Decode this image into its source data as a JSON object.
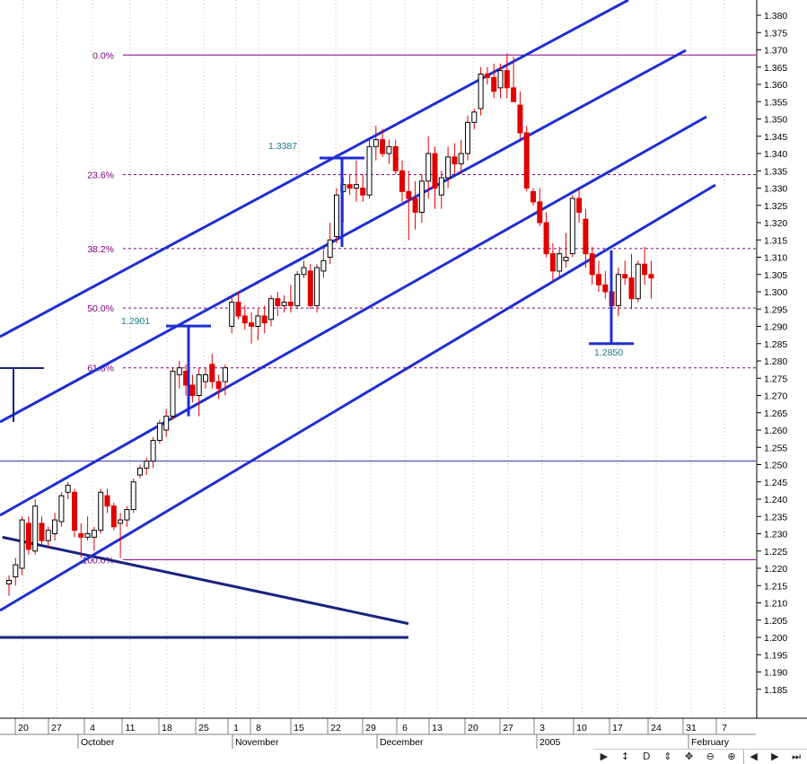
{
  "colors": {
    "background": "#ffffff",
    "grid": "#c0c0c0",
    "axis_text": "#000000",
    "up_candle": "#ffffff",
    "down_candle": "#e00000",
    "wick": "#e00000",
    "fib": "#800080",
    "fib_label": "#800080",
    "trend": "#1f2fd0",
    "dark_line": "#1a237e",
    "annotation": "#1a7a8a",
    "hline": "#3030c0"
  },
  "toolbar": {
    "play_label": "▶",
    "cycle_label": "↕",
    "d_label": "D",
    "updown_label": "⇕",
    "move_label": "✥",
    "zoom_out_label": "⊖",
    "zoom_in_label": "⊕",
    "left_label": "◀",
    "right_label": "▶",
    "end_label": "⏭"
  },
  "chart_data": {
    "type": "candlestick",
    "title": "",
    "xlabel": "",
    "ylabel": "",
    "ylim": [
      1.181,
      1.385
    ],
    "y_ticks": [
      "1.380",
      "1.375",
      "1.370",
      "1.365",
      "1.360",
      "1.355",
      "1.350",
      "1.345",
      "1.340",
      "1.335",
      "1.330",
      "1.325",
      "1.320",
      "1.315",
      "1.310",
      "1.305",
      "1.300",
      "1.295",
      "1.290",
      "1.285",
      "1.280",
      "1.275",
      "1.270",
      "1.265",
      "1.260",
      "1.255",
      "1.250",
      "1.245",
      "1.240",
      "1.235",
      "1.230",
      "1.225",
      "1.220",
      "1.215",
      "1.210",
      "1.205",
      "1.200",
      "1.195",
      "1.190",
      "1.185"
    ],
    "x_day_ticks": [
      "20",
      "27",
      "4",
      "11",
      "18",
      "25",
      "1",
      "8",
      "15",
      "22",
      "29",
      "6",
      "13",
      "20",
      "27",
      "3",
      "10",
      "17",
      "24",
      "31",
      "7"
    ],
    "x_month_labels": [
      "October",
      "November",
      "December",
      "2005",
      "February"
    ],
    "grid": "vertical weekly dotted",
    "fibonacci_levels": [
      {
        "label": "0.0%",
        "value": 1.3685
      },
      {
        "label": "23.6%",
        "value": 1.3339
      },
      {
        "label": "38.2%",
        "value": 1.3125
      },
      {
        "label": "50.0%",
        "value": 1.2953
      },
      {
        "label": "61.8%",
        "value": 1.278
      },
      {
        "label": "100.0%",
        "value": 1.2225
      }
    ],
    "annotations": [
      {
        "label": "1.3387",
        "value": 1.3387
      },
      {
        "label": "1.2901",
        "value": 1.2901
      },
      {
        "label": "1.2850",
        "value": 1.285
      }
    ],
    "horizontal_lines": [
      1.251,
      1.2
    ],
    "trend_channel_lines": [
      {
        "x1": -1,
        "y1": 1.288,
        "x2": 50,
        "y2": 1.385
      },
      {
        "x1": -1,
        "y1": 1.261,
        "x2": 54,
        "y2": 1.369
      },
      {
        "x1": -1,
        "y1": 1.235,
        "x2": 55,
        "y2": 1.349
      },
      {
        "x1": -1,
        "y1": 1.211,
        "x2": 56,
        "y2": 1.329
      }
    ],
    "descending_line": {
      "x1": -1,
      "y1": 1.229,
      "x2": 31,
      "y2": 1.204
    },
    "candles": [
      {
        "o": 1.2155,
        "h": 1.218,
        "l": 1.212,
        "c": 1.2165
      },
      {
        "o": 1.2175,
        "h": 1.223,
        "l": 1.215,
        "c": 1.221
      },
      {
        "o": 1.22,
        "h": 1.235,
        "l": 1.218,
        "c": 1.234
      },
      {
        "o": 1.233,
        "h": 1.235,
        "l": 1.224,
        "c": 1.2255
      },
      {
        "o": 1.225,
        "h": 1.24,
        "l": 1.224,
        "c": 1.238
      },
      {
        "o": 1.233,
        "h": 1.235,
        "l": 1.227,
        "c": 1.228
      },
      {
        "o": 1.228,
        "h": 1.232,
        "l": 1.226,
        "c": 1.231
      },
      {
        "o": 1.23,
        "h": 1.236,
        "l": 1.228,
        "c": 1.234
      },
      {
        "o": 1.2335,
        "h": 1.242,
        "l": 1.232,
        "c": 1.241
      },
      {
        "o": 1.242,
        "h": 1.245,
        "l": 1.24,
        "c": 1.244
      },
      {
        "o": 1.242,
        "h": 1.243,
        "l": 1.229,
        "c": 1.231
      },
      {
        "o": 1.23,
        "h": 1.233,
        "l": 1.223,
        "c": 1.229
      },
      {
        "o": 1.229,
        "h": 1.235,
        "l": 1.228,
        "c": 1.23
      },
      {
        "o": 1.229,
        "h": 1.232,
        "l": 1.225,
        "c": 1.231
      },
      {
        "o": 1.231,
        "h": 1.243,
        "l": 1.23,
        "c": 1.242
      },
      {
        "o": 1.241,
        "h": 1.243,
        "l": 1.236,
        "c": 1.238
      },
      {
        "o": 1.238,
        "h": 1.239,
        "l": 1.231,
        "c": 1.232
      },
      {
        "o": 1.233,
        "h": 1.236,
        "l": 1.223,
        "c": 1.234
      },
      {
        "o": 1.234,
        "h": 1.238,
        "l": 1.232,
        "c": 1.237
      },
      {
        "o": 1.237,
        "h": 1.246,
        "l": 1.236,
        "c": 1.245
      },
      {
        "o": 1.247,
        "h": 1.25,
        "l": 1.246,
        "c": 1.249
      },
      {
        "o": 1.249,
        "h": 1.252,
        "l": 1.247,
        "c": 1.251
      },
      {
        "o": 1.251,
        "h": 1.258,
        "l": 1.249,
        "c": 1.257
      },
      {
        "o": 1.257,
        "h": 1.263,
        "l": 1.256,
        "c": 1.262
      },
      {
        "o": 1.26,
        "h": 1.266,
        "l": 1.258,
        "c": 1.264
      },
      {
        "o": 1.264,
        "h": 1.278,
        "l": 1.263,
        "c": 1.277
      },
      {
        "o": 1.276,
        "h": 1.28,
        "l": 1.272,
        "c": 1.278
      },
      {
        "o": 1.277,
        "h": 1.279,
        "l": 1.27,
        "c": 1.273
      },
      {
        "o": 1.273,
        "h": 1.276,
        "l": 1.268,
        "c": 1.27
      },
      {
        "o": 1.27,
        "h": 1.278,
        "l": 1.264,
        "c": 1.276
      },
      {
        "o": 1.274,
        "h": 1.278,
        "l": 1.272,
        "c": 1.276
      },
      {
        "o": 1.279,
        "h": 1.282,
        "l": 1.272,
        "c": 1.274
      },
      {
        "o": 1.274,
        "h": 1.276,
        "l": 1.269,
        "c": 1.272
      },
      {
        "o": 1.274,
        "h": 1.279,
        "l": 1.27,
        "c": 1.278
      },
      {
        "o": 1.29,
        "h": 1.299,
        "l": 1.288,
        "c": 1.297
      },
      {
        "o": 1.297,
        "h": 1.3,
        "l": 1.292,
        "c": 1.293
      },
      {
        "o": 1.293,
        "h": 1.296,
        "l": 1.289,
        "c": 1.291
      },
      {
        "o": 1.291,
        "h": 1.294,
        "l": 1.285,
        "c": 1.29
      },
      {
        "o": 1.29,
        "h": 1.295,
        "l": 1.286,
        "c": 1.293
      },
      {
        "o": 1.293,
        "h": 1.296,
        "l": 1.288,
        "c": 1.291
      },
      {
        "o": 1.292,
        "h": 1.299,
        "l": 1.29,
        "c": 1.298
      },
      {
        "o": 1.298,
        "h": 1.3,
        "l": 1.293,
        "c": 1.296
      },
      {
        "o": 1.296,
        "h": 1.299,
        "l": 1.294,
        "c": 1.297
      },
      {
        "o": 1.297,
        "h": 1.302,
        "l": 1.294,
        "c": 1.296
      },
      {
        "o": 1.296,
        "h": 1.306,
        "l": 1.295,
        "c": 1.305
      },
      {
        "o": 1.305,
        "h": 1.309,
        "l": 1.304,
        "c": 1.307
      },
      {
        "o": 1.306,
        "h": 1.308,
        "l": 1.295,
        "c": 1.296
      },
      {
        "o": 1.296,
        "h": 1.308,
        "l": 1.294,
        "c": 1.307
      },
      {
        "o": 1.306,
        "h": 1.312,
        "l": 1.304,
        "c": 1.309
      },
      {
        "o": 1.31,
        "h": 1.32,
        "l": 1.308,
        "c": 1.315
      },
      {
        "o": 1.316,
        "h": 1.33,
        "l": 1.314,
        "c": 1.328
      },
      {
        "o": 1.329,
        "h": 1.333,
        "l": 1.32,
        "c": 1.331
      },
      {
        "o": 1.331,
        "h": 1.334,
        "l": 1.328,
        "c": 1.33
      },
      {
        "o": 1.33,
        "h": 1.338,
        "l": 1.326,
        "c": 1.331
      },
      {
        "o": 1.33,
        "h": 1.334,
        "l": 1.326,
        "c": 1.328
      },
      {
        "o": 1.328,
        "h": 1.344,
        "l": 1.327,
        "c": 1.342
      },
      {
        "o": 1.342,
        "h": 1.348,
        "l": 1.338,
        "c": 1.344
      },
      {
        "o": 1.344,
        "h": 1.347,
        "l": 1.339,
        "c": 1.34
      },
      {
        "o": 1.34,
        "h": 1.344,
        "l": 1.337,
        "c": 1.342
      },
      {
        "o": 1.342,
        "h": 1.344,
        "l": 1.334,
        "c": 1.335
      },
      {
        "o": 1.335,
        "h": 1.338,
        "l": 1.326,
        "c": 1.329
      },
      {
        "o": 1.329,
        "h": 1.335,
        "l": 1.315,
        "c": 1.327
      },
      {
        "o": 1.327,
        "h": 1.332,
        "l": 1.318,
        "c": 1.323
      },
      {
        "o": 1.323,
        "h": 1.334,
        "l": 1.32,
        "c": 1.332
      },
      {
        "o": 1.332,
        "h": 1.345,
        "l": 1.327,
        "c": 1.34
      },
      {
        "o": 1.34,
        "h": 1.342,
        "l": 1.324,
        "c": 1.33
      },
      {
        "o": 1.328,
        "h": 1.335,
        "l": 1.324,
        "c": 1.333
      },
      {
        "o": 1.333,
        "h": 1.342,
        "l": 1.33,
        "c": 1.339
      },
      {
        "o": 1.339,
        "h": 1.343,
        "l": 1.334,
        "c": 1.337
      },
      {
        "o": 1.337,
        "h": 1.344,
        "l": 1.334,
        "c": 1.34
      },
      {
        "o": 1.34,
        "h": 1.351,
        "l": 1.338,
        "c": 1.349
      },
      {
        "o": 1.349,
        "h": 1.353,
        "l": 1.347,
        "c": 1.352
      },
      {
        "o": 1.353,
        "h": 1.365,
        "l": 1.351,
        "c": 1.363
      },
      {
        "o": 1.363,
        "h": 1.365,
        "l": 1.36,
        "c": 1.362
      },
      {
        "o": 1.362,
        "h": 1.366,
        "l": 1.356,
        "c": 1.358
      },
      {
        "o": 1.359,
        "h": 1.366,
        "l": 1.356,
        "c": 1.364
      },
      {
        "o": 1.364,
        "h": 1.369,
        "l": 1.356,
        "c": 1.359
      },
      {
        "o": 1.359,
        "h": 1.368,
        "l": 1.355,
        "c": 1.355
      },
      {
        "o": 1.354,
        "h": 1.358,
        "l": 1.344,
        "c": 1.346
      },
      {
        "o": 1.346,
        "h": 1.348,
        "l": 1.329,
        "c": 1.33
      },
      {
        "o": 1.329,
        "h": 1.33,
        "l": 1.325,
        "c": 1.326
      },
      {
        "o": 1.326,
        "h": 1.33,
        "l": 1.319,
        "c": 1.32
      },
      {
        "o": 1.32,
        "h": 1.323,
        "l": 1.31,
        "c": 1.311
      },
      {
        "o": 1.311,
        "h": 1.314,
        "l": 1.303,
        "c": 1.306
      },
      {
        "o": 1.306,
        "h": 1.313,
        "l": 1.304,
        "c": 1.311
      },
      {
        "o": 1.309,
        "h": 1.317,
        "l": 1.307,
        "c": 1.31
      },
      {
        "o": 1.311,
        "h": 1.328,
        "l": 1.31,
        "c": 1.327
      },
      {
        "o": 1.327,
        "h": 1.33,
        "l": 1.32,
        "c": 1.323
      },
      {
        "o": 1.321,
        "h": 1.324,
        "l": 1.307,
        "c": 1.311
      },
      {
        "o": 1.311,
        "h": 1.313,
        "l": 1.302,
        "c": 1.305
      },
      {
        "o": 1.305,
        "h": 1.309,
        "l": 1.3,
        "c": 1.302
      },
      {
        "o": 1.302,
        "h": 1.306,
        "l": 1.298,
        "c": 1.3
      },
      {
        "o": 1.3,
        "h": 1.306,
        "l": 1.292,
        "c": 1.296
      },
      {
        "o": 1.296,
        "h": 1.307,
        "l": 1.293,
        "c": 1.305
      },
      {
        "o": 1.305,
        "h": 1.309,
        "l": 1.302,
        "c": 1.304
      },
      {
        "o": 1.304,
        "h": 1.311,
        "l": 1.295,
        "c": 1.298
      },
      {
        "o": 1.298,
        "h": 1.309,
        "l": 1.297,
        "c": 1.308
      },
      {
        "o": 1.308,
        "h": 1.313,
        "l": 1.302,
        "c": 1.305
      },
      {
        "o": 1.305,
        "h": 1.309,
        "l": 1.298,
        "c": 1.304
      }
    ]
  }
}
